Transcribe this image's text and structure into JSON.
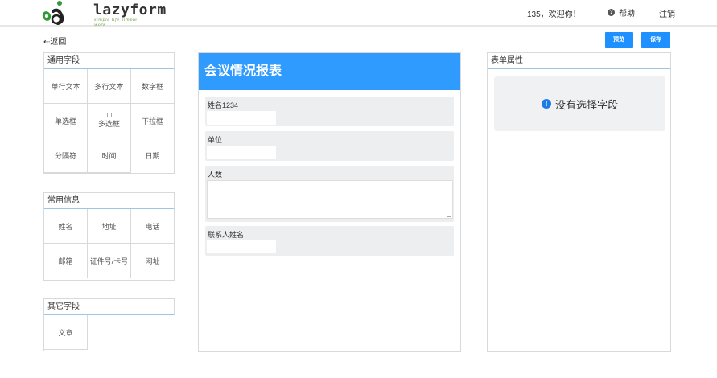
{
  "header": {
    "logo_text": "lazyform",
    "logo_tagline": "simple life simple work",
    "user_greeting": "135，欢迎你！",
    "help_label": "帮助",
    "logout_label": "注销"
  },
  "toolbar": {
    "back_label": "返回",
    "preview_label": "预览",
    "save_label": "保存"
  },
  "palettes": {
    "common_fields": {
      "title": "通用字段",
      "items": [
        "单行文本",
        "多行文本",
        "数字框",
        "单选框",
        "多选框",
        "下拉框",
        "分隔符",
        "时间",
        "日期"
      ]
    },
    "common_info": {
      "title": "常用信息",
      "items": [
        "姓名",
        "地址",
        "电话",
        "邮箱",
        "证件号/卡号",
        "网址"
      ]
    },
    "other_fields": {
      "title": "其它字段",
      "items": [
        "文章"
      ]
    }
  },
  "form": {
    "title": "会议情况报表",
    "fields": [
      {
        "label": "姓名1234",
        "type": "text"
      },
      {
        "label": "单位",
        "type": "text"
      },
      {
        "label": "人数",
        "type": "textarea"
      },
      {
        "label": "联系人姓名",
        "type": "text"
      }
    ]
  },
  "properties": {
    "title": "表单属性",
    "empty_message": "没有选择字段"
  },
  "colors": {
    "accent": "#1e90ff",
    "form_header": "#2f9bff",
    "field_bg": "#edeef0"
  }
}
